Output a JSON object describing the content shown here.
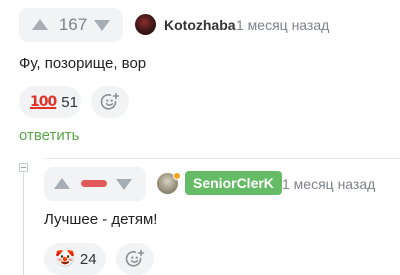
{
  "comment1": {
    "vote_count": "167",
    "username": "Kotozhaba",
    "time": "1 месяц назад",
    "text": "Фу, позорище, вор",
    "reaction": {
      "emoji": "💯",
      "count": "51"
    },
    "reply_label": "ответить"
  },
  "comment2": {
    "username": "SeniorClerK",
    "time": "1 месяц назад",
    "text": "Лучшее - детям!",
    "reaction": {
      "emoji": "🤡",
      "count": "24"
    }
  },
  "colors": {
    "accent_green": "#5aa64a",
    "badge_green": "#66bb66",
    "minus_red": "#e05a5a",
    "online_orange": "#f2a51a"
  },
  "icons": [
    "upvote-icon",
    "downvote-icon",
    "add-reaction-icon",
    "collapse-icon"
  ]
}
